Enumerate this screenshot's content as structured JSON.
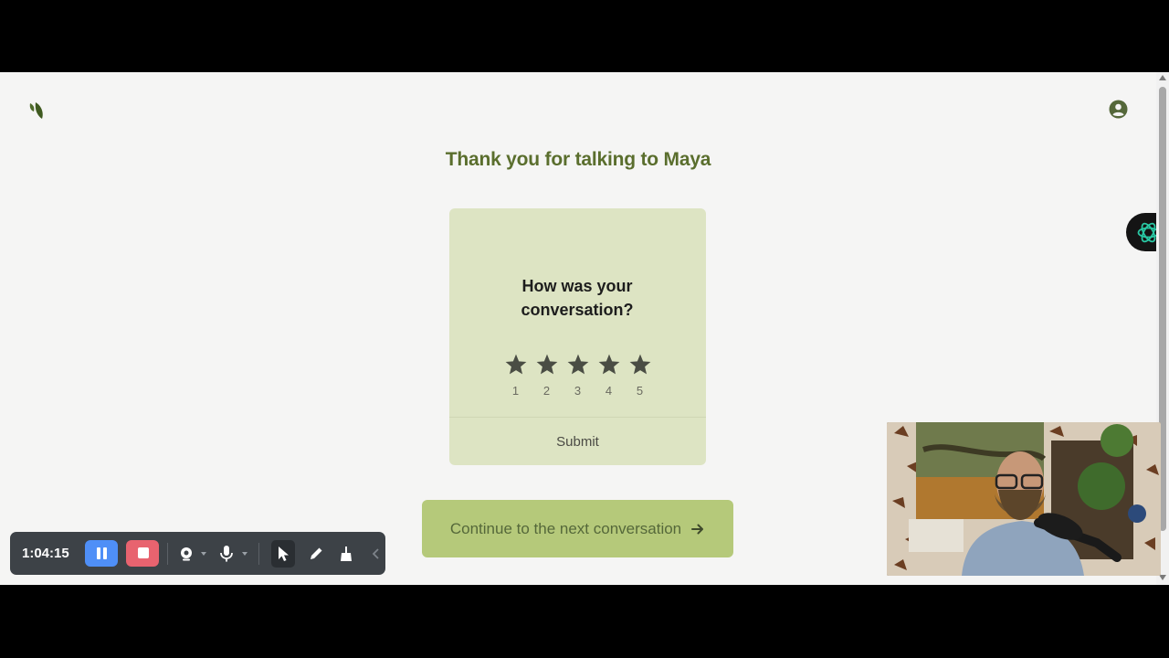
{
  "page": {
    "title": "Thank you for talking to Maya"
  },
  "feedback": {
    "question": "How was your conversation?",
    "rating_labels": [
      "1",
      "2",
      "3",
      "4",
      "5"
    ],
    "submit_label": "Submit"
  },
  "continue_label": "Continue to the next conversation",
  "recorder": {
    "elapsed": "1:04:15"
  },
  "icons": {
    "logo": "leaf-logo-icon",
    "account": "user-circle-icon",
    "extension": "openai-logo-icon",
    "continue_arrow": "arrow-right-icon"
  },
  "colors": {
    "accent_text": "#5a6e2d",
    "card_bg": "#dde4c3",
    "continue_bg": "#b5c97a",
    "page_bg": "#f5f5f4",
    "recorder_pause": "#4f8ff7",
    "recorder_stop": "#e8636f"
  }
}
